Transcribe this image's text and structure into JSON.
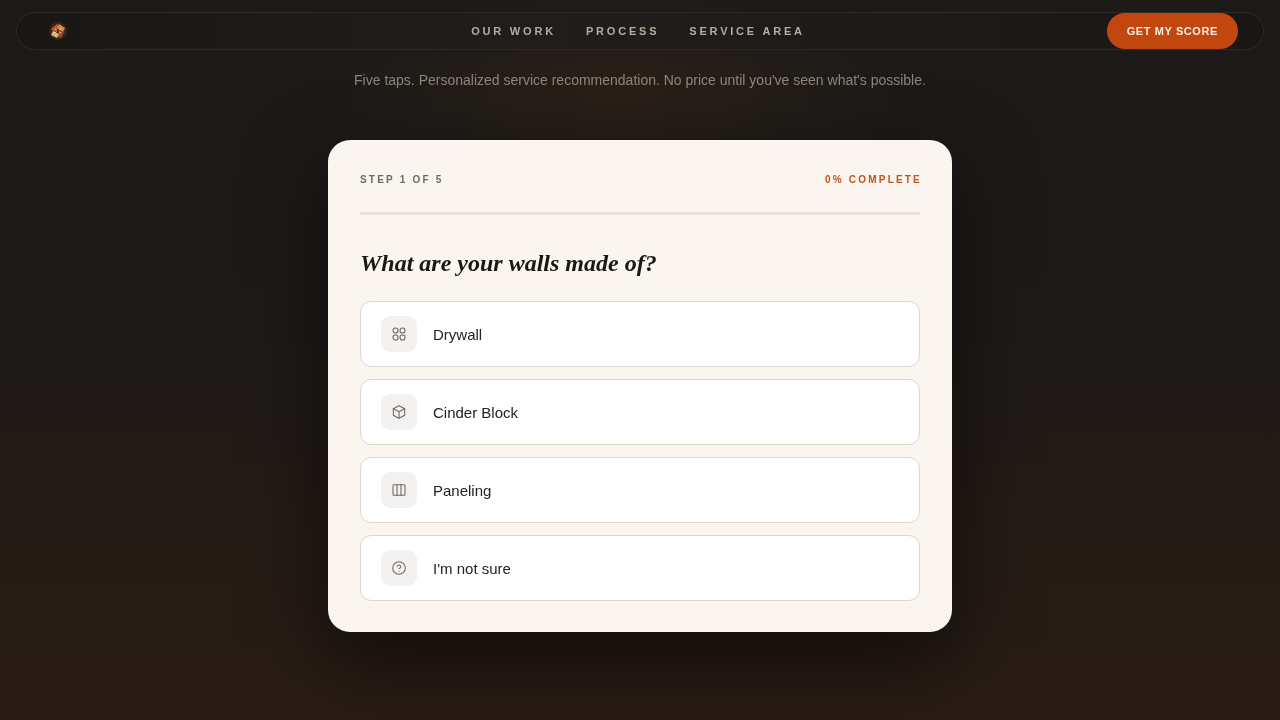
{
  "nav": {
    "links": [
      "OUR WORK",
      "PROCESS",
      "SERVICE AREA"
    ],
    "cta": "GET MY SCORE"
  },
  "subtitle": "Five taps. Personalized service recommendation. No price until you've seen what's possible.",
  "quiz": {
    "step": "STEP 1 OF 5",
    "progress_label": "0% COMPLETE",
    "level": 0,
    "question": "What are your walls made of?",
    "options": [
      {
        "label": "Drywall",
        "selected": false
      },
      {
        "label": "Cinder Block",
        "selected": false
      },
      {
        "label": "Paneling",
        "selected": false
      },
      {
        "label": "I'm not sure",
        "selected": false
      }
    ]
  }
}
